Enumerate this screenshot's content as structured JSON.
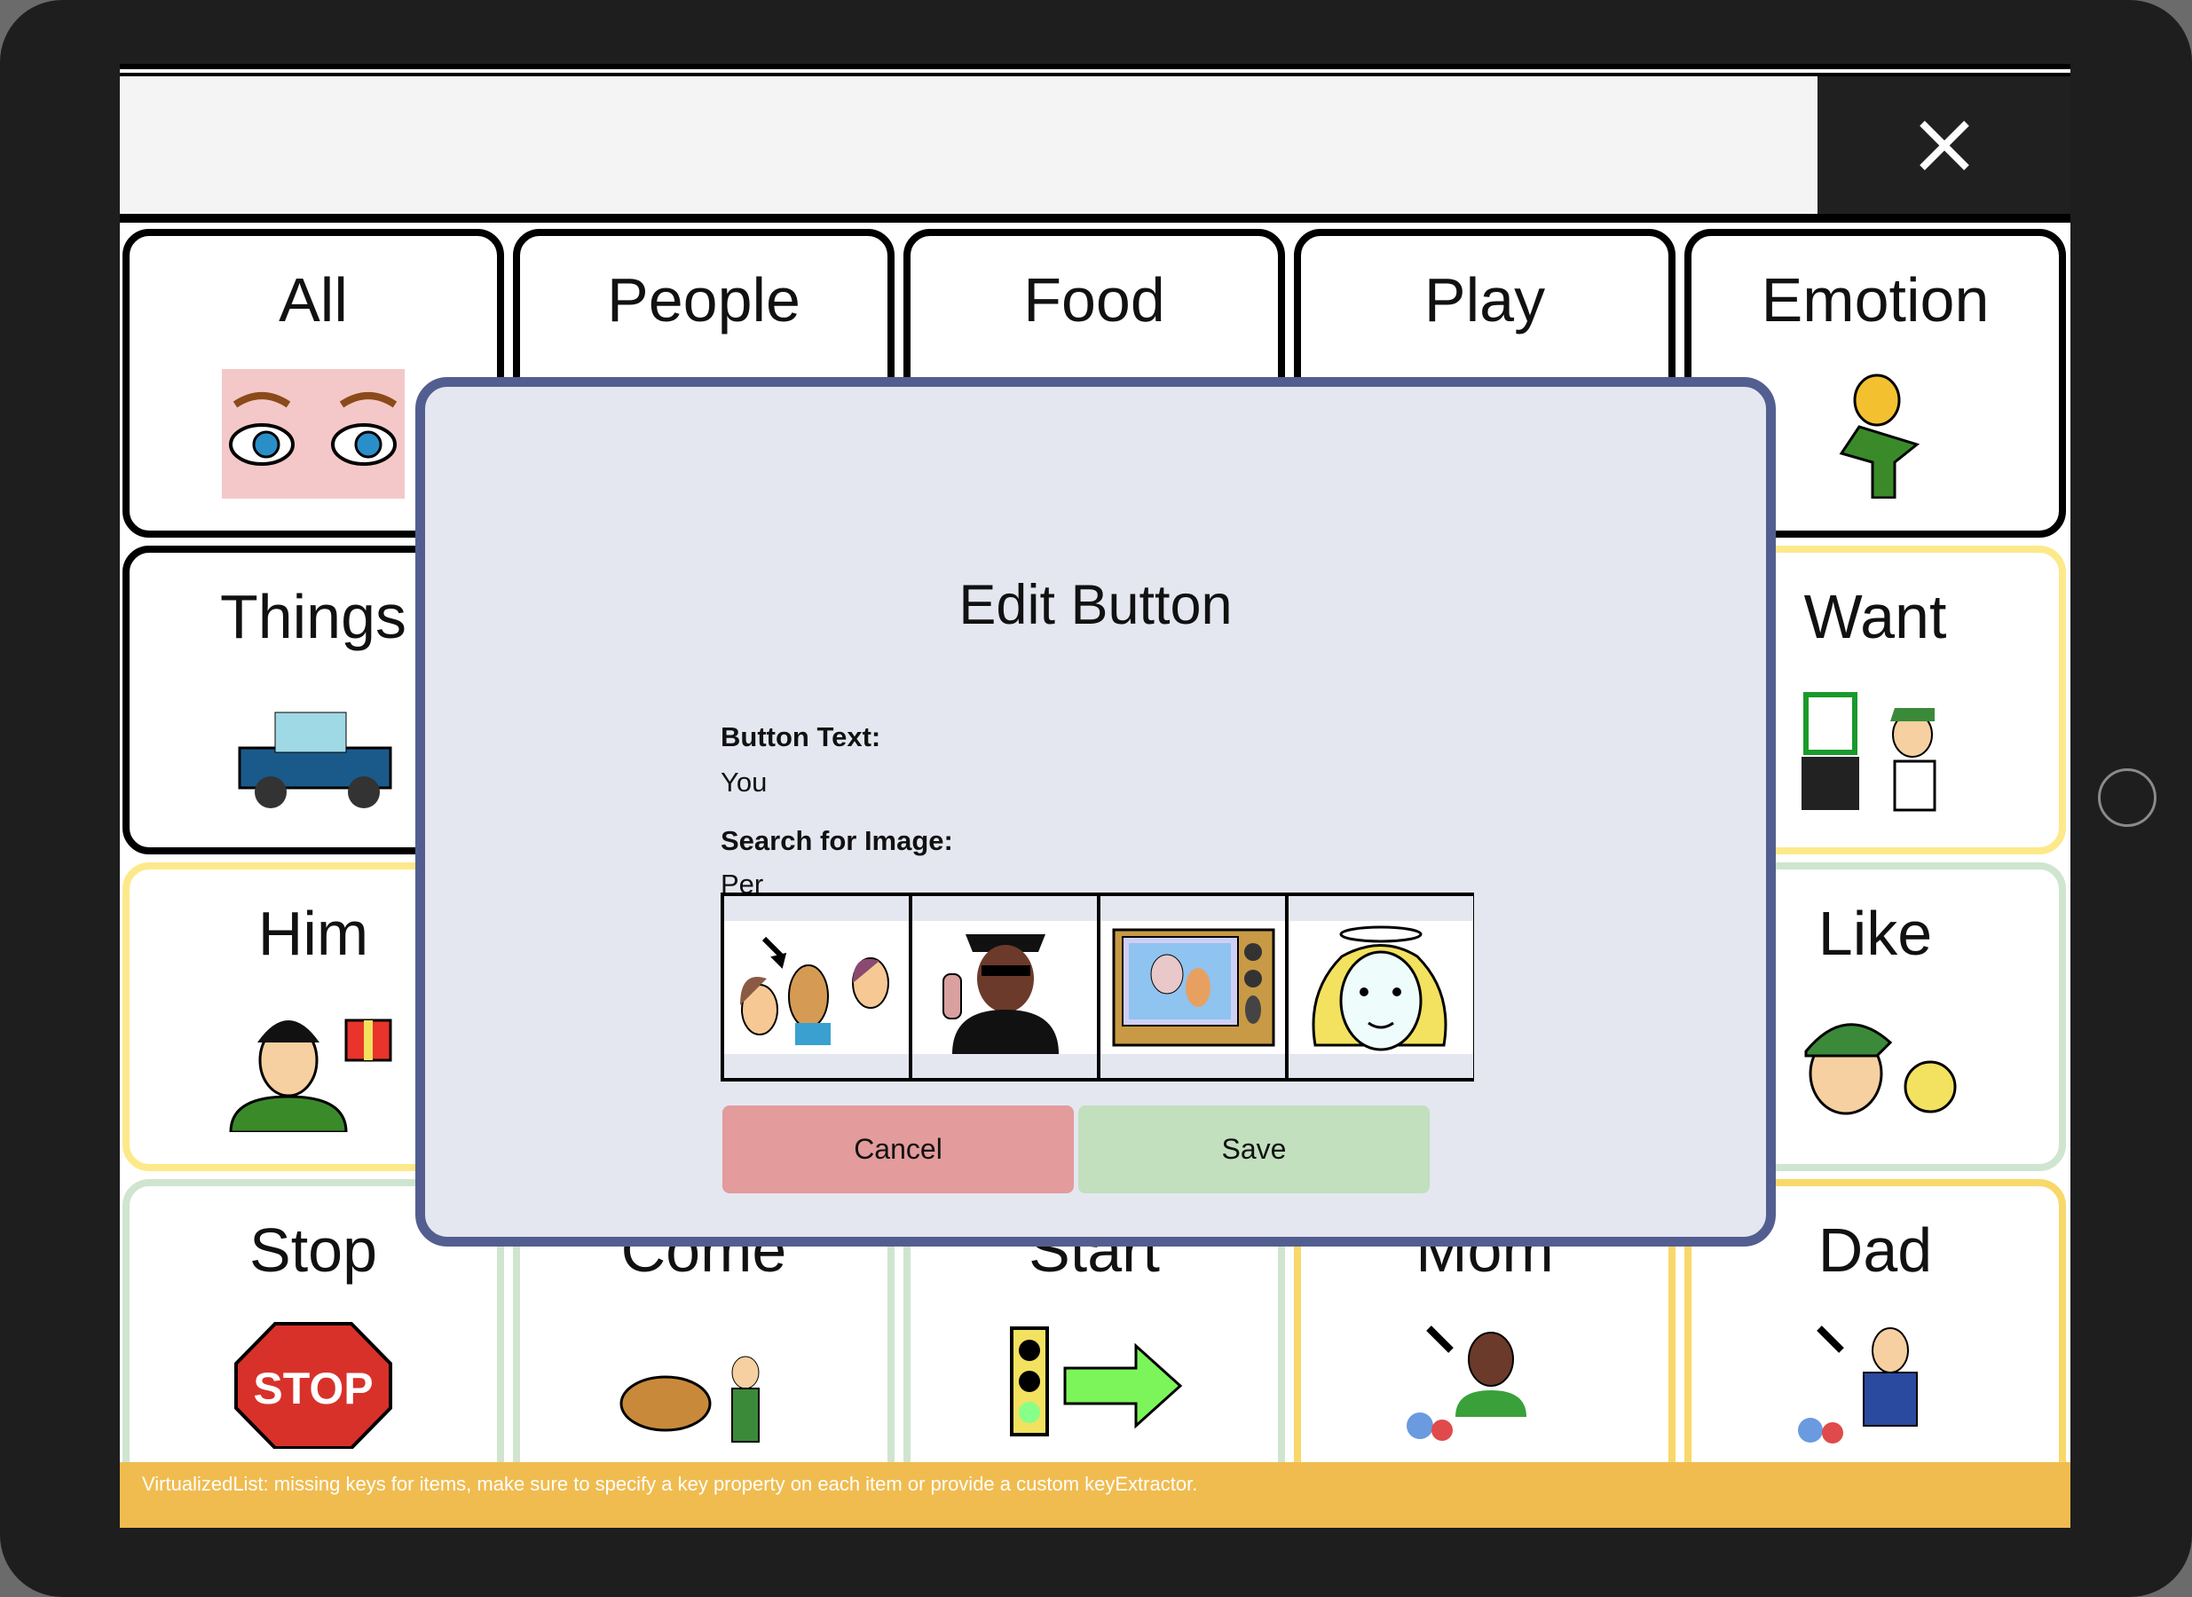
{
  "search": {
    "value": "",
    "close_icon": "close-icon"
  },
  "grid": [
    {
      "label": "All",
      "border": "#000000",
      "icon": "eyes-icon"
    },
    {
      "label": "People",
      "border": "#000000",
      "icon": "people-icon"
    },
    {
      "label": "Food",
      "border": "#000000",
      "icon": "food-icon"
    },
    {
      "label": "Play",
      "border": "#000000",
      "icon": "play-icon"
    },
    {
      "label": "Emotion",
      "border": "#000000",
      "icon": "emotion-mask-icon"
    },
    {
      "label": "Things",
      "border": "#000000",
      "icon": "truck-icon"
    },
    {
      "label": "Want",
      "border": "#fde98a",
      "icon": "want-icon"
    },
    {
      "label": "Him",
      "border": "#fde98a",
      "icon": "him-gift-icon"
    },
    {
      "label": "Like",
      "border": "#cfe5cf",
      "icon": "like-sun-icon"
    },
    {
      "label": "Stop",
      "border": "#cfe5cf",
      "icon": "stop-sign-icon"
    },
    {
      "label": "Come",
      "border": "#cfe5cf",
      "icon": "dog-come-icon"
    },
    {
      "label": "Start",
      "border": "#cfe5cf",
      "icon": "traffic-light-arrow-icon"
    },
    {
      "label": "Mom",
      "border": "#f9d86a",
      "icon": "mom-icon"
    },
    {
      "label": "Dad",
      "border": "#f9d86a",
      "icon": "dad-icon"
    }
  ],
  "dialog": {
    "title": "Edit Button",
    "button_text_label": "Button Text:",
    "button_text_value": "You",
    "search_label": "Search for Image:",
    "search_value": "Per",
    "results": [
      "person-pointing-icon",
      "police-officer-icon",
      "tv-personality-icon",
      "angel-person-icon"
    ],
    "cancel_label": "Cancel",
    "save_label": "Save",
    "cancel_color": "#e39b9b",
    "save_color": "#c2dfbe"
  },
  "warning": "VirtualizedList: missing keys for items, make sure to specify a key property on each item or provide a custom keyExtractor."
}
